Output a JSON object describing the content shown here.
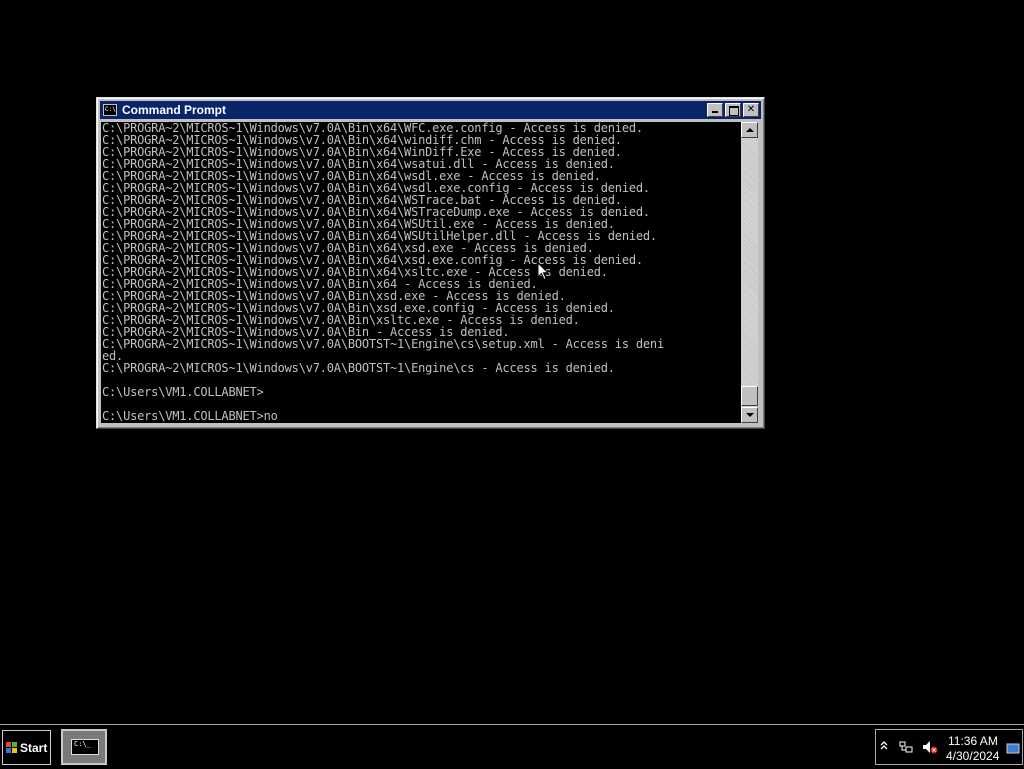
{
  "window": {
    "title": "Command Prompt",
    "icon": "cmd-icon",
    "lines": [
      "C:\\PROGRA~2\\MICROS~1\\Windows\\v7.0A\\Bin\\x64\\WFC.exe.config - Access is denied.",
      "C:\\PROGRA~2\\MICROS~1\\Windows\\v7.0A\\Bin\\x64\\windiff.chm - Access is denied.",
      "C:\\PROGRA~2\\MICROS~1\\Windows\\v7.0A\\Bin\\x64\\WinDiff.Exe - Access is denied.",
      "C:\\PROGRA~2\\MICROS~1\\Windows\\v7.0A\\Bin\\x64\\wsatui.dll - Access is denied.",
      "C:\\PROGRA~2\\MICROS~1\\Windows\\v7.0A\\Bin\\x64\\wsdl.exe - Access is denied.",
      "C:\\PROGRA~2\\MICROS~1\\Windows\\v7.0A\\Bin\\x64\\wsdl.exe.config - Access is denied.",
      "C:\\PROGRA~2\\MICROS~1\\Windows\\v7.0A\\Bin\\x64\\WSTrace.bat - Access is denied.",
      "C:\\PROGRA~2\\MICROS~1\\Windows\\v7.0A\\Bin\\x64\\WSTraceDump.exe - Access is denied.",
      "C:\\PROGRA~2\\MICROS~1\\Windows\\v7.0A\\Bin\\x64\\WSUtil.exe - Access is denied.",
      "C:\\PROGRA~2\\MICROS~1\\Windows\\v7.0A\\Bin\\x64\\WSUtilHelper.dll - Access is denied.",
      "C:\\PROGRA~2\\MICROS~1\\Windows\\v7.0A\\Bin\\x64\\xsd.exe - Access is denied.",
      "C:\\PROGRA~2\\MICROS~1\\Windows\\v7.0A\\Bin\\x64\\xsd.exe.config - Access is denied.",
      "C:\\PROGRA~2\\MICROS~1\\Windows\\v7.0A\\Bin\\x64\\xsltc.exe - Access is denied.",
      "C:\\PROGRA~2\\MICROS~1\\Windows\\v7.0A\\Bin\\x64 - Access is denied.",
      "C:\\PROGRA~2\\MICROS~1\\Windows\\v7.0A\\Bin\\xsd.exe - Access is denied.",
      "C:\\PROGRA~2\\MICROS~1\\Windows\\v7.0A\\Bin\\xsd.exe.config - Access is denied.",
      "C:\\PROGRA~2\\MICROS~1\\Windows\\v7.0A\\Bin\\xsltc.exe - Access is denied.",
      "C:\\PROGRA~2\\MICROS~1\\Windows\\v7.0A\\Bin - Access is denied.",
      "C:\\PROGRA~2\\MICROS~1\\Windows\\v7.0A\\BOOTST~1\\Engine\\cs\\setup.xml - Access is deni",
      "ed.",
      "C:\\PROGRA~2\\MICROS~1\\Windows\\v7.0A\\BOOTST~1\\Engine\\cs - Access is denied.",
      "",
      "C:\\Users\\VM1.COLLABNET>",
      "",
      "C:\\Users\\VM1.COLLABNET>no"
    ]
  },
  "taskbar": {
    "start_label": "Start",
    "task_icon_text": "C:\\_",
    "clock_time": "11:36 AM",
    "clock_date": "4/30/2024"
  },
  "colors": {
    "titlebar": "#0a246a",
    "console_bg": "#000000",
    "console_fg": "#c0c0c0"
  }
}
